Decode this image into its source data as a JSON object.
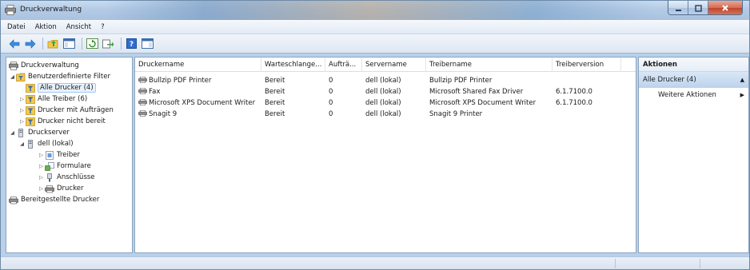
{
  "window": {
    "title": "Druckverwaltung",
    "icon": "printer-management-icon",
    "controls": [
      "minimize-icon",
      "maximize-icon",
      "close-icon"
    ]
  },
  "menu": {
    "items": [
      "Datei",
      "Aktion",
      "Ansicht",
      "?"
    ]
  },
  "toolbar": {
    "buttons": [
      "back-arrow-icon",
      "forward-arrow-icon",
      "up-folder-icon",
      "show-hide-tree-icon",
      "refresh-icon",
      "export-list-icon",
      "help-icon",
      "show-hide-action-pane-icon"
    ]
  },
  "tree": {
    "items": [
      {
        "label": "Druckverwaltung",
        "level": 0,
        "arrow": "",
        "icon": "printer-management-icon"
      },
      {
        "label": "Benutzerdefinierte Filter",
        "level": 1,
        "arrow": "◢",
        "icon": "filter-folder-icon"
      },
      {
        "label": "Alle Drucker (4)",
        "level": 2,
        "arrow": "",
        "icon": "filter-icon",
        "selected": true
      },
      {
        "label": "Alle Treiber (6)",
        "level": 2,
        "arrow": "▷",
        "icon": "filter-icon"
      },
      {
        "label": "Drucker mit Aufträgen",
        "level": 2,
        "arrow": "▷",
        "icon": "filter-icon"
      },
      {
        "label": "Drucker nicht bereit",
        "level": 2,
        "arrow": "▷",
        "icon": "filter-icon"
      },
      {
        "label": "Druckserver",
        "level": 1,
        "arrow": "◢",
        "icon": "server-icon"
      },
      {
        "label": "dell (lokal)",
        "level": 2,
        "arrow": "◢",
        "icon": "server-icon"
      },
      {
        "label": "Treiber",
        "level": 3,
        "arrow": "▷",
        "icon": "driver-icon"
      },
      {
        "label": "Formulare",
        "level": 3,
        "arrow": "▷",
        "icon": "forms-icon"
      },
      {
        "label": "Anschlüsse",
        "level": 3,
        "arrow": "▷",
        "icon": "ports-icon"
      },
      {
        "label": "Drucker",
        "level": 3,
        "arrow": "▷",
        "icon": "printer-icon"
      },
      {
        "label": "Bereitgestellte Drucker",
        "level": 0,
        "arrow": "",
        "icon": "printer-icon"
      }
    ]
  },
  "list": {
    "columns": [
      "Druckername",
      "Warteschlange...",
      "Aufträ...",
      "Servername",
      "Treibername",
      "Treiberversion"
    ],
    "rows": [
      [
        "Bullzip PDF Printer",
        "Bereit",
        "0",
        "dell (lokal)",
        "Bullzip PDF Printer",
        ""
      ],
      [
        "Fax",
        "Bereit",
        "0",
        "dell (lokal)",
        "Microsoft Shared Fax Driver",
        "6.1.7100.0"
      ],
      [
        "Microsoft XPS Document Writer",
        "Bereit",
        "0",
        "dell (lokal)",
        "Microsoft XPS Document Writer",
        "6.1.7100.0"
      ],
      [
        "Snagit 9",
        "Bereit",
        "0",
        "dell (lokal)",
        "Snagit 9 Printer",
        ""
      ]
    ]
  },
  "actions": {
    "header": "Aktionen",
    "section": "Alle Drucker (4)",
    "items": [
      "Weitere Aktionen"
    ]
  },
  "colors": {
    "titlebar": "#b4cbe6",
    "pane_border": "#8ca4c0",
    "selection": "#e8f2fe",
    "action_section": "#bcd2ec"
  }
}
